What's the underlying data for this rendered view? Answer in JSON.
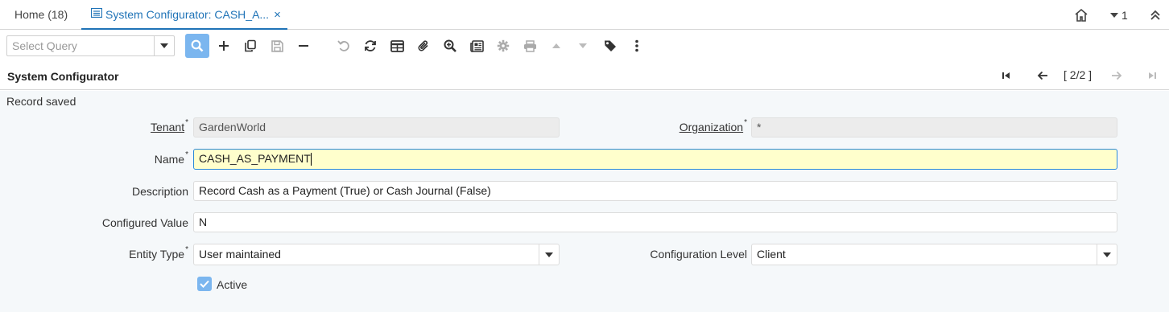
{
  "tabs": {
    "home": "Home (18)",
    "active": "System Configurator: CASH_A...",
    "close": "×"
  },
  "header_right": {
    "notification_count": "1"
  },
  "toolbar": {
    "query_placeholder": "Select Query"
  },
  "window": {
    "title": "System Configurator",
    "record_nav": "[ 2/2 ]"
  },
  "status": "Record saved",
  "form": {
    "tenant_label": "Tenant",
    "tenant_value": "GardenWorld",
    "organization_label": "Organization",
    "organization_value": "*",
    "name_label": "Name",
    "name_value": "CASH_AS_PAYMENT",
    "description_label": "Description",
    "description_value": "Record Cash as a Payment (True) or Cash Journal (False)",
    "configured_value_label": "Configured Value",
    "configured_value": "N",
    "entity_type_label": "Entity Type",
    "entity_type_value": "User maintained",
    "configuration_level_label": "Configuration Level",
    "configuration_level_value": "Client",
    "active_label": "Active",
    "required_mark": "*"
  },
  "colors": {
    "accent": "#1f73b7",
    "search_bg": "#7bb6ef",
    "active_field_bg": "#ffffcc",
    "content_bg": "#f5f8fa"
  }
}
